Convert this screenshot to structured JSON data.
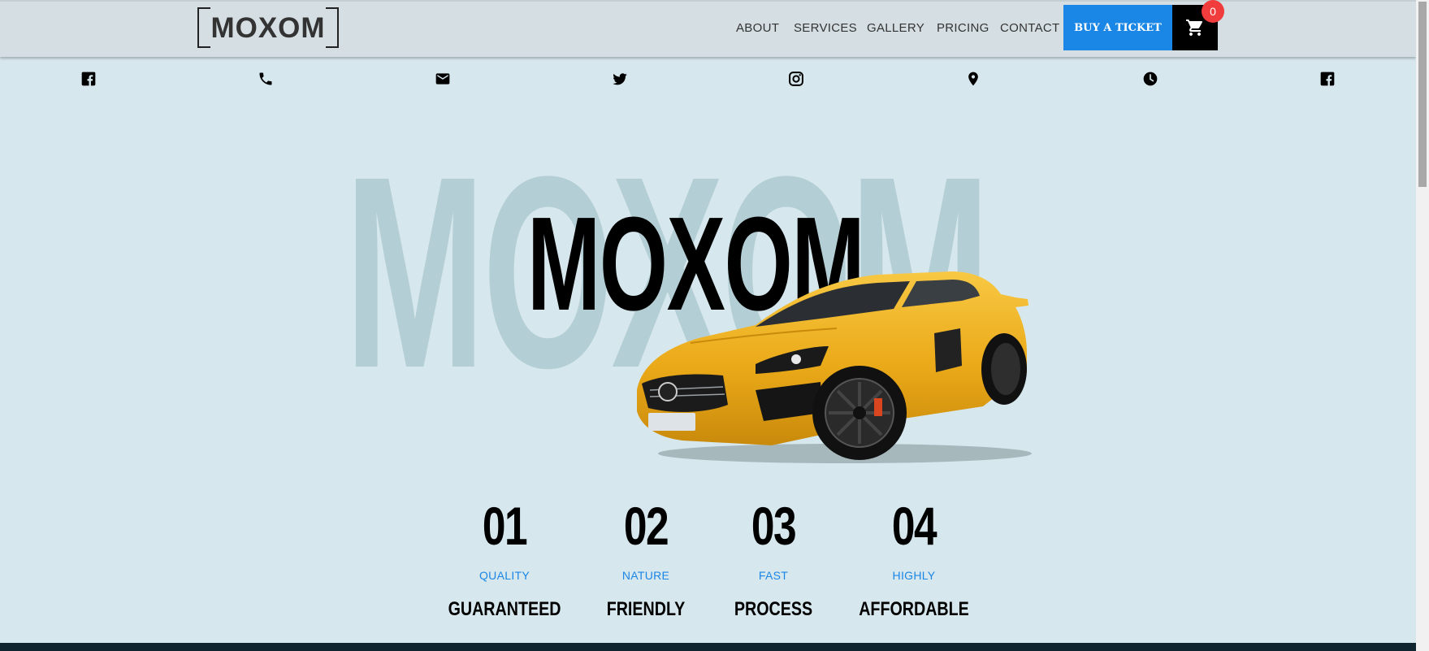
{
  "header": {
    "logo": "MOXOM",
    "nav": [
      "ABOUT",
      "SERVICES",
      "GALLERY",
      "PRICING",
      "CONTACT"
    ],
    "buy_label": "BUY A TICKET",
    "cart_count": "0"
  },
  "social_icons": [
    "facebook-icon",
    "phone-icon",
    "mail-icon",
    "twitter-icon",
    "instagram-icon",
    "location-pin-icon",
    "clock-icon",
    "facebook-icon"
  ],
  "hero": {
    "background_text": "MOXOM",
    "title": "MOXOM"
  },
  "features": [
    {
      "number": "01",
      "label": "QUALITY",
      "title": "GUARANTEED"
    },
    {
      "number": "02",
      "label": "NATURE",
      "title": "FRIENDLY"
    },
    {
      "number": "03",
      "label": "FAST",
      "title": "PROCESS"
    },
    {
      "number": "04",
      "label": "HIGHLY",
      "title": "AFFORDABLE"
    }
  ],
  "colors": {
    "accent": "#1a86e5",
    "background": "#d6e7ed",
    "badge": "#f03c3c",
    "car": "#f2b321"
  }
}
